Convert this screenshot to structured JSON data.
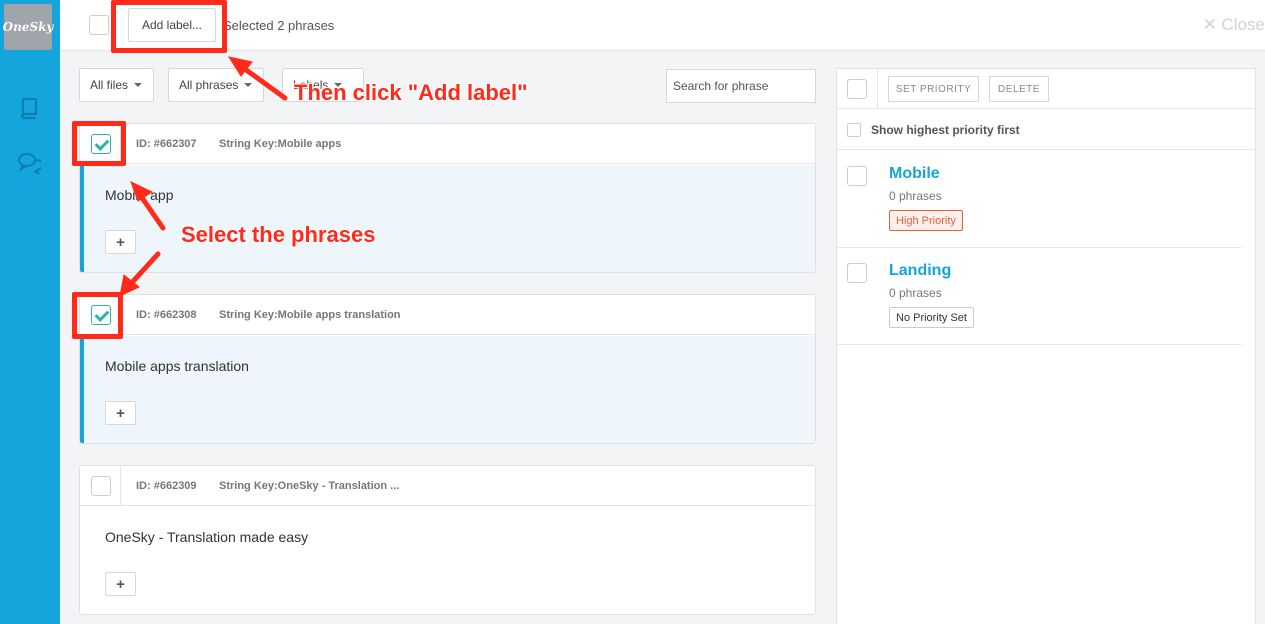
{
  "app": {
    "logo_text": "OneSky"
  },
  "sidebar": {
    "icons": [
      "book-icon",
      "chat-icon"
    ]
  },
  "topbar": {
    "add_label": "Add label...",
    "selected_text": "Selected 2 phrases",
    "close_label": "✕ Close"
  },
  "filters": {
    "files": "All files",
    "phrases": "All phrases",
    "labels": "Labels",
    "search_placeholder": "Search for phrase"
  },
  "phrases": [
    {
      "id": "ID: #662307",
      "key": "String Key:Mobile apps",
      "text": "Mobile app",
      "checked": true
    },
    {
      "id": "ID: #662308",
      "key": "String Key:Mobile apps translation",
      "text": "Mobile apps translation",
      "checked": true
    },
    {
      "id": "ID: #662309",
      "key": "String Key:OneSky - Translation ...",
      "text": "OneSky - Translation made easy",
      "checked": false
    }
  ],
  "panel": {
    "set_priority": "SET PRIORITY",
    "delete": "DELETE",
    "sort_label": "Show highest priority first",
    "labels": [
      {
        "name": "Mobile",
        "count": "0 phrases",
        "priority": "High Priority"
      },
      {
        "name": "Landing",
        "count": "0 phrases",
        "priority": "No Priority Set"
      }
    ]
  },
  "annotations": {
    "add_label_note": "Then click \"Add label\"",
    "select_note": "Select the phrases",
    "color": "#ff2a1a"
  },
  "colors": {
    "brand": "#14a5dc",
    "check": "#2ab3a6",
    "high_priority": "#e8603c"
  },
  "plus_glyph": "+"
}
